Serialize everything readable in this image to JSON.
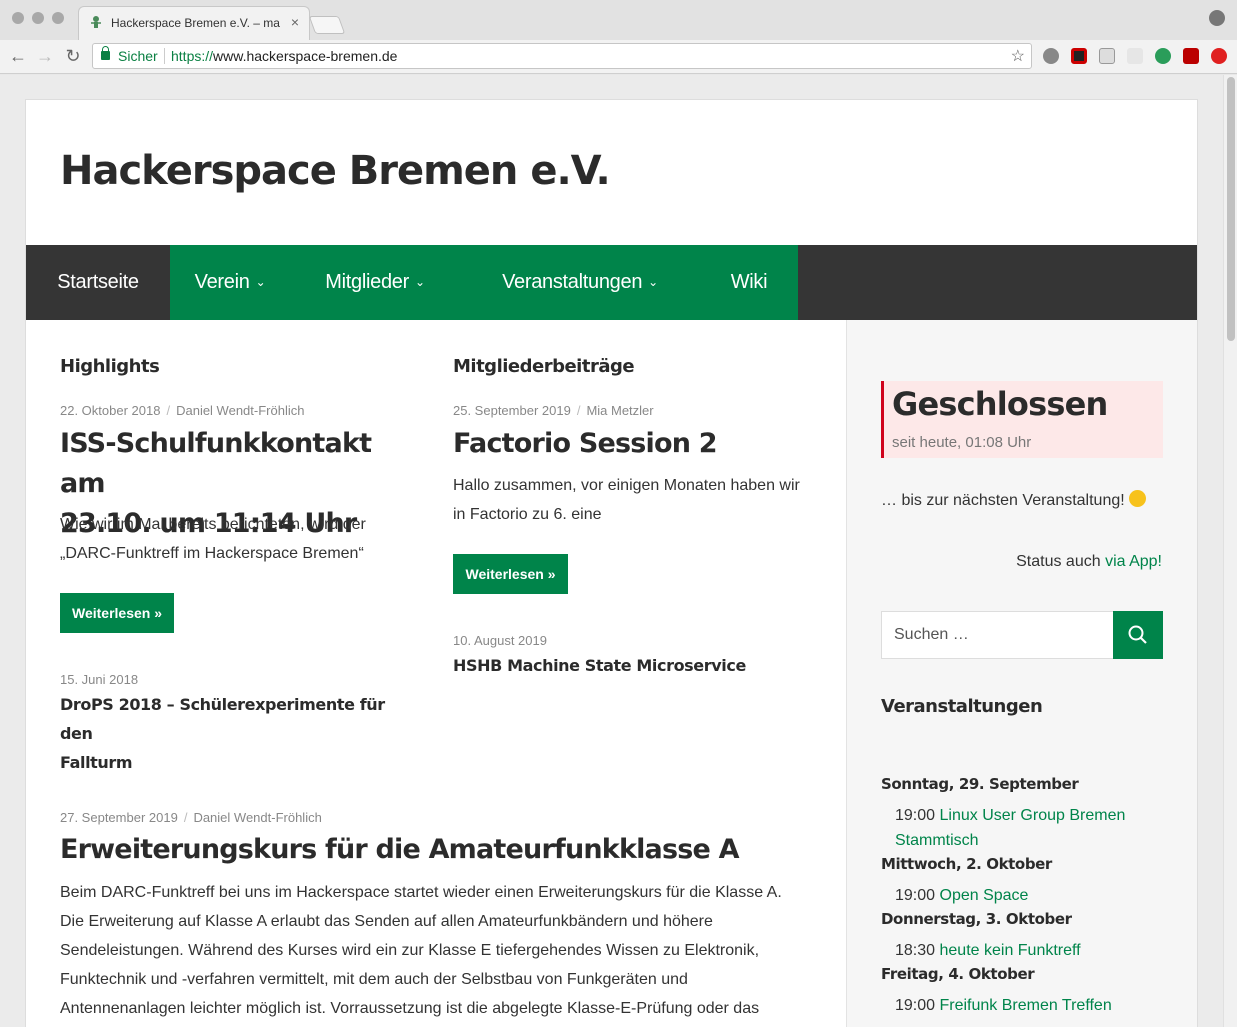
{
  "browser": {
    "tab_title": "Hackerspace Bremen e.V. – ma",
    "secure_label": "Sicher",
    "url_scheme": "https://",
    "url_rest": "www.hackerspace-bremen.de"
  },
  "site": {
    "title": "Hackerspace Bremen e.V."
  },
  "nav": {
    "items": [
      {
        "label": "Startseite"
      },
      {
        "label": "Verein"
      },
      {
        "label": "Mitglieder"
      },
      {
        "label": "Veranstaltungen"
      },
      {
        "label": "Wiki"
      }
    ]
  },
  "highlights": {
    "heading": "Highlights",
    "post": {
      "date": "22. Oktober 2018",
      "author": "Daniel Wendt-Fröhlich",
      "title_line1": "ISS-Schulfunkkontakt am",
      "title_line2": "23.10. um 11:14 Uhr",
      "excerpt_line1": "Wie wir im Mai bereits berichteten, wird der",
      "excerpt_line2": "„DARC-Funktreff im Hackerspace Bremen“",
      "button": "Weiterlesen »"
    },
    "small_post": {
      "date": "15. Juni 2018",
      "title_line1": "DroPS 2018 – Schülerexperimente für den",
      "title_line2": "Fallturm"
    }
  },
  "members": {
    "heading": "Mitgliederbeiträge",
    "post": {
      "date": "25. September 2019",
      "author": "Mia Metzler",
      "title": "Factorio Session 2",
      "excerpt_line1": "Hallo zusammen, vor einigen Monaten haben wir",
      "excerpt_line2": "in Factorio zu 6. eine",
      "button": "Weiterlesen »"
    },
    "small_post": {
      "date": "10. August 2019",
      "title": "HSHB Machine State Microservice"
    }
  },
  "article": {
    "date": "27. September 2019",
    "author": "Daniel Wendt-Fröhlich",
    "title": "Erweiterungskurs für die Amateurfunkklasse A",
    "lines": [
      "Beim DARC-Funktreff bei uns im Hackerspace startet wieder einen Erweiterungskurs für die Klasse A.",
      "Die Erweiterung auf Klasse A erlaubt das Senden auf allen Amateurfunkbändern und höhere",
      "Sendeleistungen. Während des Kurses wird ein zur Klasse E tiefergehendes Wissen zu Elektronik,",
      "Funktechnik und -verfahren vermittelt, mit dem auch der Selbstbau von Funkgeräten und",
      "Antennenanlagen leichter möglich ist. Vorraussetzung ist die abgelegte Klasse-E-Prüfung oder das"
    ]
  },
  "sidebar": {
    "status_title": "Geschlossen",
    "status_since": "seit heute, 01:08 Uhr",
    "status_next": "… bis zur nächsten Veranstaltung!",
    "app_prefix": "Status auch",
    "app_link": "via App!",
    "search_placeholder": "Suchen …",
    "events_heading": "Veranstaltungen",
    "events": [
      {
        "day": "Sonntag, 29. September",
        "time": "19:00",
        "title": "Linux User Group Bremen Stammtisch"
      },
      {
        "day": "Mittwoch, 2. Oktober",
        "time": "19:00",
        "title": "Open Space"
      },
      {
        "day": "Donnerstag, 3. Oktober",
        "time": "18:30",
        "title": "heute kein Funktreff"
      },
      {
        "day": "Freitag, 4. Oktober",
        "time": "19:00",
        "title": "Freifunk Bremen Treffen"
      }
    ]
  },
  "colors": {
    "brand_green": "#00844a",
    "nav_dark": "#353535",
    "closed_red": "#d0021b"
  },
  "icons": [
    "back-arrow-icon",
    "forward-arrow-icon",
    "reload-icon",
    "lock-icon",
    "star-icon",
    "search-icon",
    "smiley-icon"
  ]
}
